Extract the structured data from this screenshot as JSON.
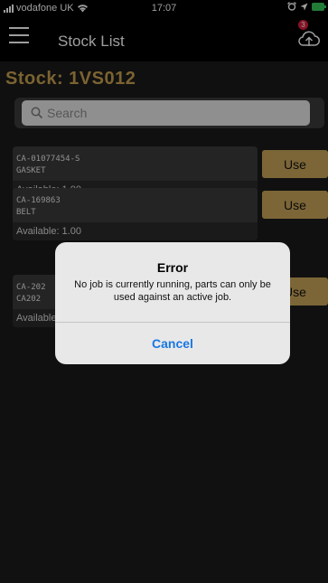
{
  "status_bar": {
    "carrier": "vodafone UK",
    "time": "17:07"
  },
  "header": {
    "title": "Stock List",
    "notification_badge": "3",
    "menu_icon": "hamburger-menu-icon",
    "upload_icon": "cloud-upload-icon"
  },
  "stock": {
    "heading": "Stock:  1VS012"
  },
  "search": {
    "placeholder": "Search",
    "value": ""
  },
  "items": [
    {
      "code": "CA-01077454-S",
      "description": "GASKET",
      "available": "Available: 1.00",
      "action_label": "Use"
    },
    {
      "code": "CA-169863",
      "description": "BELT",
      "available": "Available: 1.00",
      "action_label": "Use"
    },
    {
      "code": "CA-202",
      "description": "CA202",
      "available": "Available: 1.00",
      "action_label": "Use"
    }
  ],
  "alert": {
    "title": "Error",
    "message": "No job is currently running, parts can only be used against an active job.",
    "cancel_label": "Cancel"
  },
  "colors": {
    "accent": "#c9a55a",
    "background": "#1b1b1b",
    "alert_button": "#1877e6",
    "badge": "#d81e3a"
  }
}
